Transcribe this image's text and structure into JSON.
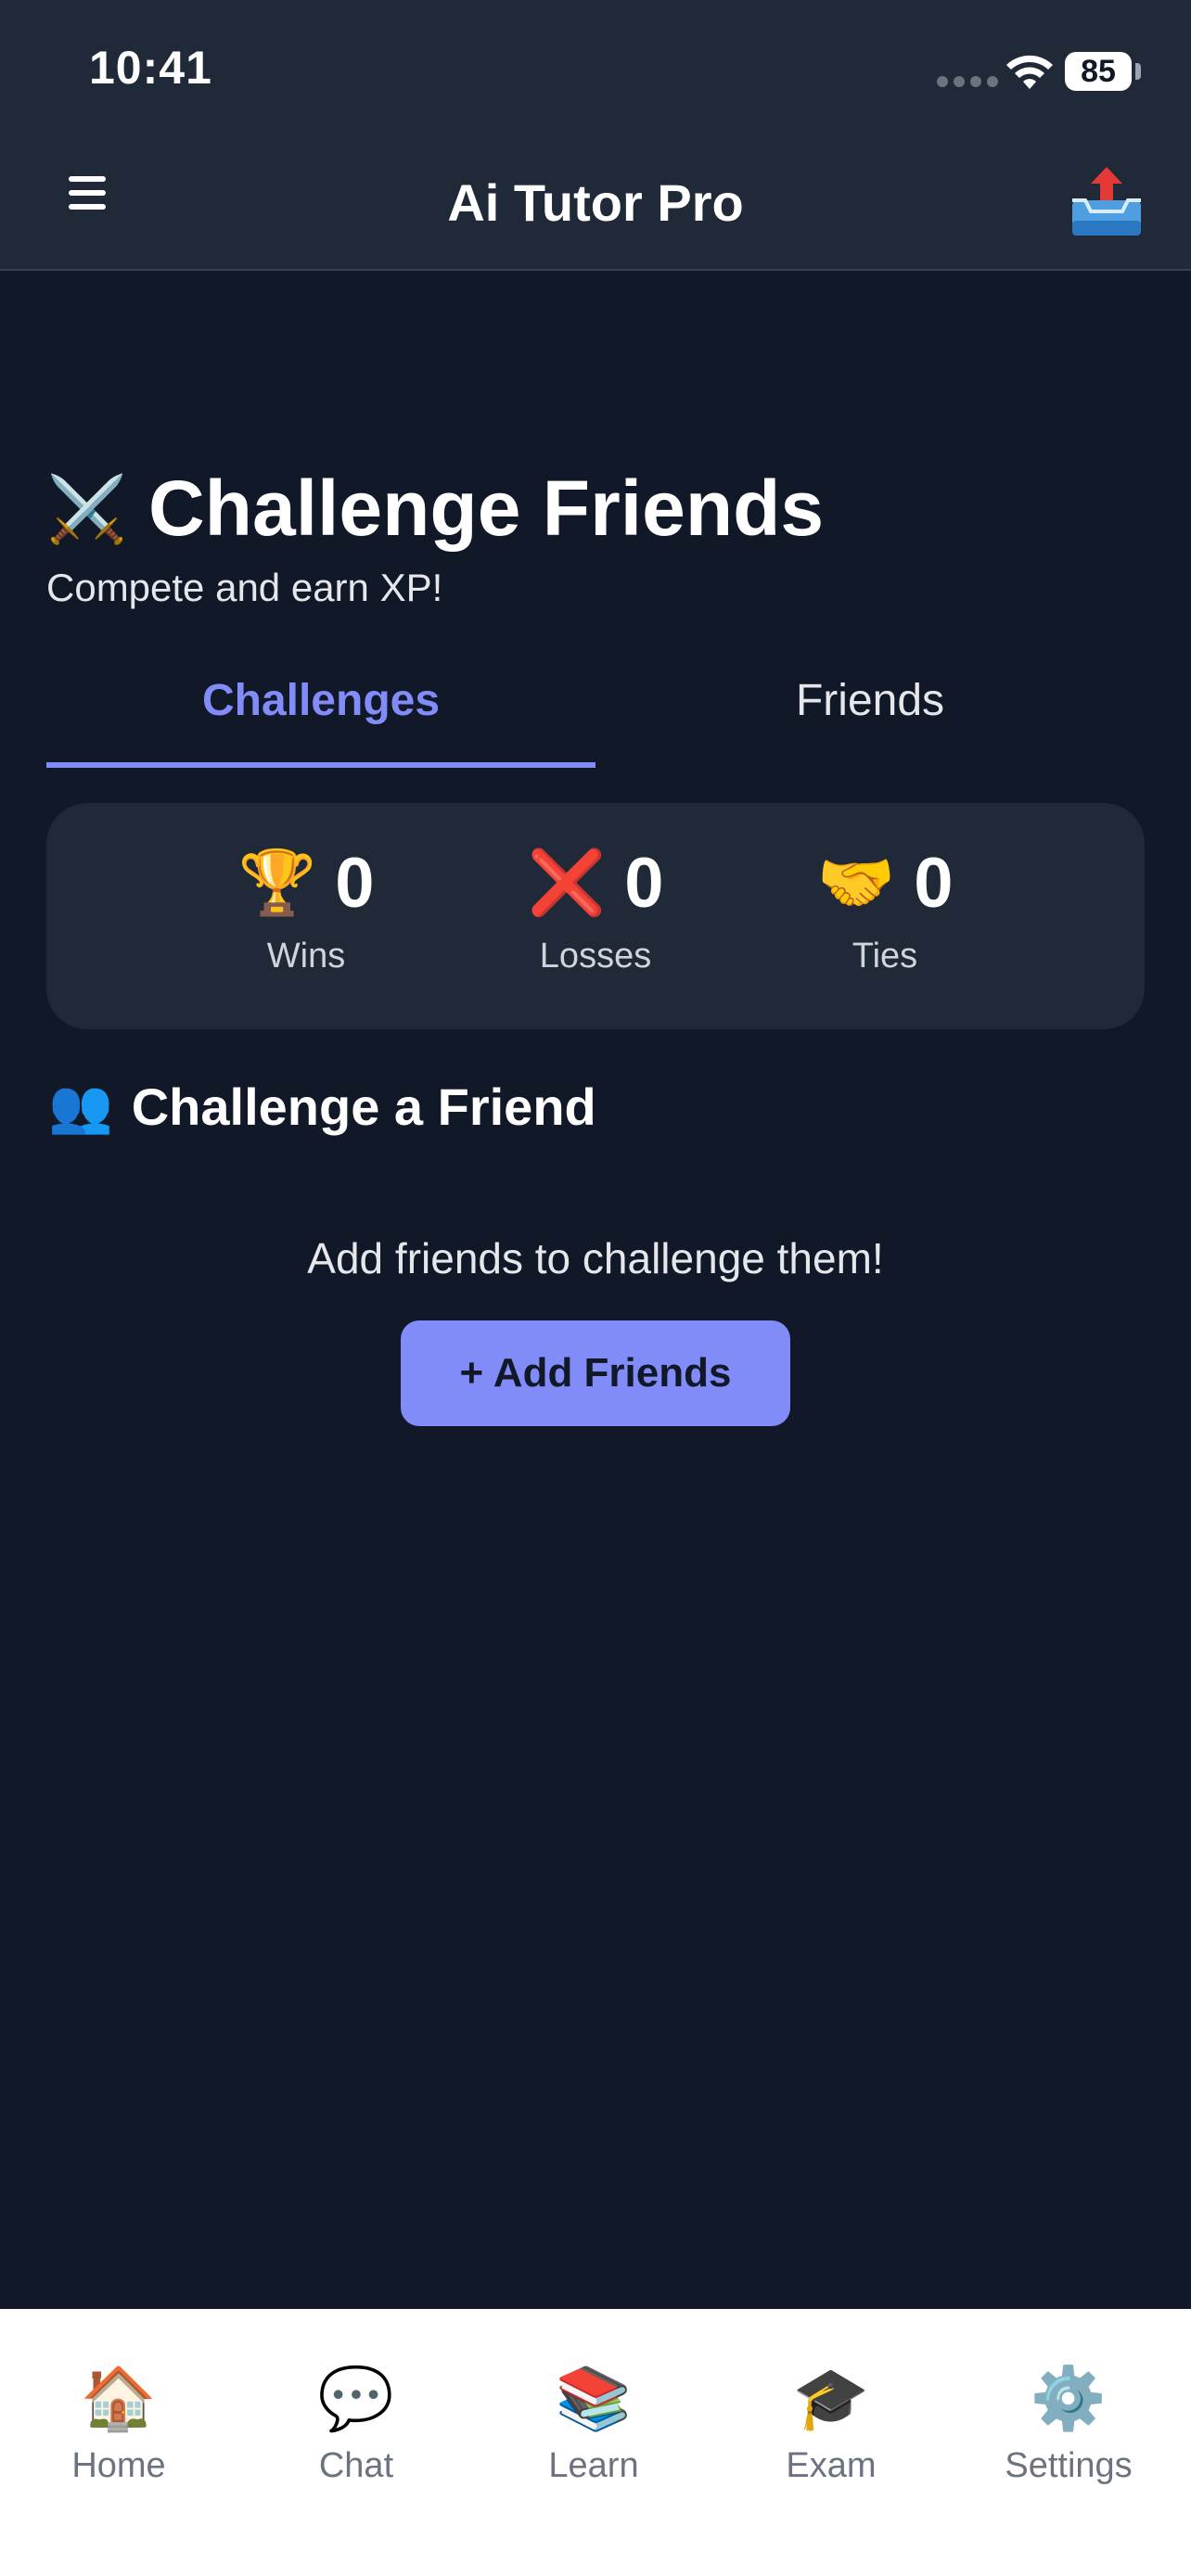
{
  "status_bar": {
    "time": "10:41",
    "battery": "85"
  },
  "header": {
    "title": "Ai Tutor Pro"
  },
  "page": {
    "title": "Challenge Friends",
    "subtitle": "Compete and earn XP!"
  },
  "tabs": [
    {
      "label": "Challenges",
      "active": true
    },
    {
      "label": "Friends",
      "active": false
    }
  ],
  "stats": [
    {
      "icon": "🏆",
      "icon_name": "trophy-icon",
      "value": "0",
      "label": "Wins"
    },
    {
      "icon": "❌",
      "icon_name": "cross-icon",
      "value": "0",
      "label": "Losses"
    },
    {
      "icon": "🤝",
      "icon_name": "handshake-icon",
      "value": "0",
      "label": "Ties"
    }
  ],
  "section": {
    "icon": "👥",
    "title": "Challenge a Friend",
    "empty_text": "Add friends to challenge them!",
    "button_label": "+ Add Friends"
  },
  "bottom_nav": [
    {
      "icon": "🏠",
      "label": "Home"
    },
    {
      "icon": "💬",
      "label": "Chat"
    },
    {
      "icon": "📚",
      "label": "Learn"
    },
    {
      "icon": "🎓",
      "label": "Exam"
    },
    {
      "icon": "⚙️",
      "label": "Settings"
    }
  ],
  "colors": {
    "background": "#111827",
    "surface": "#1f2937",
    "accent": "#818cf8"
  }
}
